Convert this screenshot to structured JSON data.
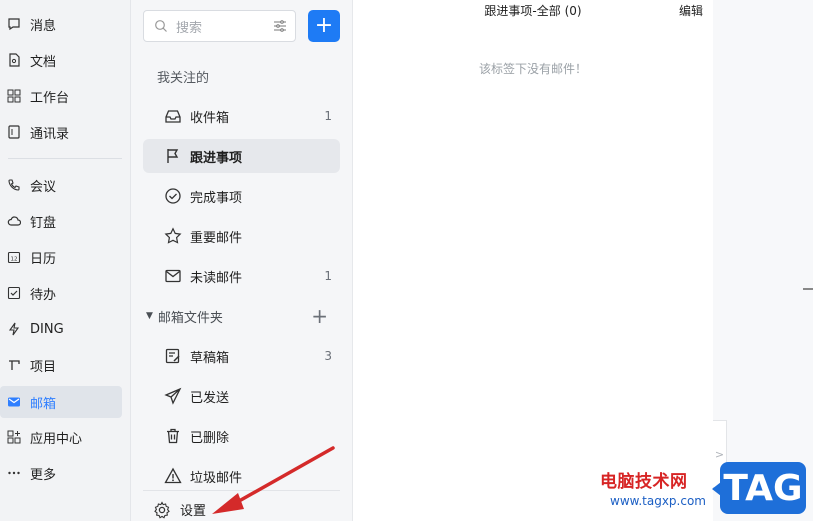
{
  "nav": {
    "items": [
      {
        "label": "消息",
        "icon": "chat-bubble-icon"
      },
      {
        "label": "文档",
        "icon": "document-icon"
      },
      {
        "label": "工作台",
        "icon": "grid-icon"
      },
      {
        "label": "通讯录",
        "icon": "contacts-icon"
      },
      {
        "label": "会议",
        "icon": "phone-icon"
      },
      {
        "label": "钉盘",
        "icon": "cloud-icon"
      },
      {
        "label": "日历",
        "icon": "calendar-icon"
      },
      {
        "label": "待办",
        "icon": "checkbox-icon"
      },
      {
        "label": "DING",
        "icon": "lightning-icon"
      },
      {
        "label": "项目",
        "icon": "project-icon"
      },
      {
        "label": "邮箱",
        "icon": "mail-icon",
        "active": true
      },
      {
        "label": "应用中心",
        "icon": "apps-icon"
      },
      {
        "label": "更多",
        "icon": "more-icon"
      }
    ]
  },
  "panel": {
    "search_placeholder": "搜索",
    "compose_label": "+",
    "section_label": "我关注的",
    "followed": [
      {
        "label": "收件箱",
        "count": "1",
        "icon": "inbox-icon"
      },
      {
        "label": "跟进事项",
        "count": "",
        "icon": "flag-icon",
        "active": true
      },
      {
        "label": "完成事项",
        "count": "",
        "icon": "check-circle-icon"
      },
      {
        "label": "重要邮件",
        "count": "",
        "icon": "star-icon"
      },
      {
        "label": "未读邮件",
        "count": "1",
        "icon": "envelope-icon"
      }
    ],
    "folder_header": "邮箱文件夹",
    "folder_add": "+",
    "folders": [
      {
        "label": "草稿箱",
        "count": "3",
        "icon": "draft-icon"
      },
      {
        "label": "已发送",
        "count": "",
        "icon": "send-icon"
      },
      {
        "label": "已删除",
        "count": "",
        "icon": "trash-icon"
      },
      {
        "label": "垃圾邮件",
        "count": "",
        "icon": "warning-icon"
      }
    ],
    "settings_label": "设置"
  },
  "main": {
    "title": "跟进事项-全部 (0)",
    "edit_label": "编辑",
    "empty_text": "该标签下没有邮件！"
  },
  "watermark": {
    "site_name": "电脑技术网",
    "url": "www.tagxp.com",
    "tag": "TAG"
  },
  "colors": {
    "accent": "#1e7bf5",
    "active_nav_text": "#2f7fff",
    "annotation_arrow": "#d42a2a"
  }
}
